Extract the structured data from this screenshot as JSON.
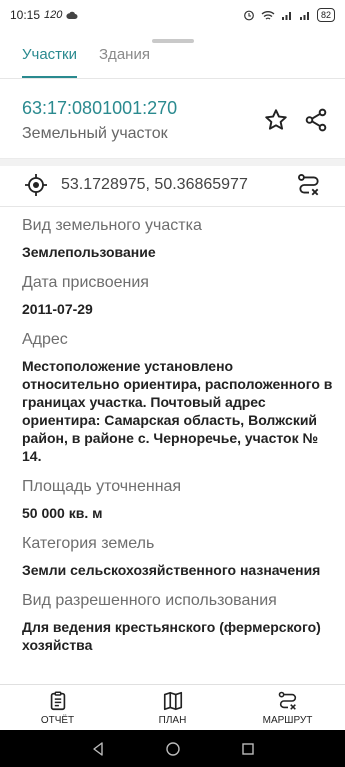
{
  "status_bar": {
    "time": "10:15",
    "net_speed": "120",
    "battery": "82"
  },
  "tabs": [
    {
      "label": "Участки",
      "active": true
    },
    {
      "label": "Здания",
      "active": false
    }
  ],
  "parcel": {
    "cadastral_number": "63:17:0801001:270",
    "type": "Земельный участок"
  },
  "coordinates": "53.1728975, 50.36865977",
  "fields": [
    {
      "label": "Вид земельного участка",
      "value": "Землепользование"
    },
    {
      "label": "Дата присвоения",
      "value": "2011-07-29"
    },
    {
      "label": "Адрес",
      "value": "Местоположение установлено относительно ориентира, расположенного в границах участка. Почтовый адрес ориентира: Самарская область, Волжский район, в районе с. Черноречье,  участок № 14."
    },
    {
      "label": "Площадь уточненная",
      "value": "50 000 кв. м"
    },
    {
      "label": "Категория земель",
      "value": "Земли сельскохозяйственного назначения"
    },
    {
      "label": "Вид разрешенного использования",
      "value": "Для  ведения крестьянского (фермерского) хозяйства"
    }
  ],
  "bottom_nav": [
    {
      "label": "ОТЧЁТ",
      "icon": "report-icon"
    },
    {
      "label": "ПЛАН",
      "icon": "map-icon"
    },
    {
      "label": "МАРШРУТ",
      "icon": "route-icon"
    }
  ],
  "colors": {
    "accent": "#2a8a8f",
    "label": "#6e6e6e",
    "value": "#222222"
  }
}
